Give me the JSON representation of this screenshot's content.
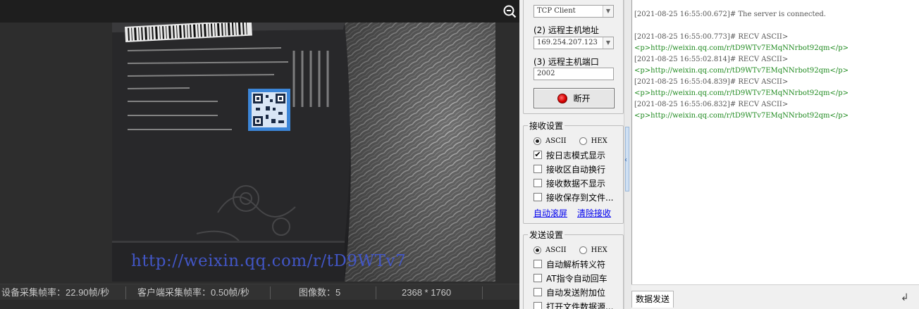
{
  "viewer": {
    "watermark_text": "http://weixin.qq.com/r/tD9WTv7",
    "status": {
      "device_fps": "设备采集帧率：22.90帧/秒",
      "client_fps": "客户端采集帧率：0.50帧/秒",
      "image_count": "图像数：5",
      "resolution": "2368 * 1760"
    },
    "zoom_icon": "zoom-out-icon"
  },
  "panel": {
    "protocol_value": "TCP Client",
    "remote_host_label": "(2) 远程主机地址",
    "remote_host_value": "169.254.207.123",
    "remote_port_label": "(3) 远程主机端口",
    "remote_port_value": "2002",
    "disconnect_label": "断开",
    "receive_group": {
      "title": "接收设置",
      "ascii_label": "ASCII",
      "hex_label": "HEX",
      "selected_encoding": "ASCII",
      "options": [
        {
          "label": "按日志模式显示",
          "checked": true
        },
        {
          "label": "接收区自动换行",
          "checked": false
        },
        {
          "label": "接收数据不显示",
          "checked": false
        },
        {
          "label": "接收保存到文件...",
          "checked": false
        }
      ],
      "auto_scroll_link": "自动滚屏",
      "clear_receive_link": "清除接收"
    },
    "send_group": {
      "title": "发送设置",
      "ascii_label": "ASCII",
      "hex_label": "HEX",
      "selected_encoding": "ASCII",
      "options": [
        {
          "label": "自动解析转义符",
          "checked": false
        },
        {
          "label": "AT指令自动回车",
          "checked": false
        },
        {
          "label": "自动发送附加位",
          "checked": false
        },
        {
          "label": "打开文件数据源...",
          "checked": false
        }
      ]
    }
  },
  "log": {
    "lines": [
      {
        "kind": "hdr",
        "text": "[2021-08-25 16:55:00.672]# The server is connected."
      },
      {
        "kind": "blank",
        "text": ""
      },
      {
        "kind": "hdr",
        "text": "[2021-08-25 16:55:00.773]# RECV ASCII>"
      },
      {
        "kind": "data",
        "text": "<p>http://weixin.qq.com/r/tD9WTv7EMqNNrbot92qm</p>"
      },
      {
        "kind": "hdr",
        "text": "[2021-08-25 16:55:02.814]# RECV ASCII>"
      },
      {
        "kind": "data",
        "text": "<p>http://weixin.qq.com/r/tD9WTv7EMqNNrbot92qm</p>"
      },
      {
        "kind": "hdr",
        "text": "[2021-08-25 16:55:04.839]# RECV ASCII>"
      },
      {
        "kind": "data",
        "text": "<p>http://weixin.qq.com/r/tD9WTv7EMqNNrbot92qm</p>"
      },
      {
        "kind": "hdr",
        "text": "[2021-08-25 16:55:06.832]# RECV ASCII>"
      },
      {
        "kind": "data",
        "text": "<p>http://weixin.qq.com/r/tD9WTv7EMqNNrbot92qm</p>"
      }
    ]
  },
  "send": {
    "tab_label": "数据发送"
  },
  "colors": {
    "log_data": "#1f8a1f",
    "watermark": "#4256c6",
    "led": "#d80000"
  }
}
